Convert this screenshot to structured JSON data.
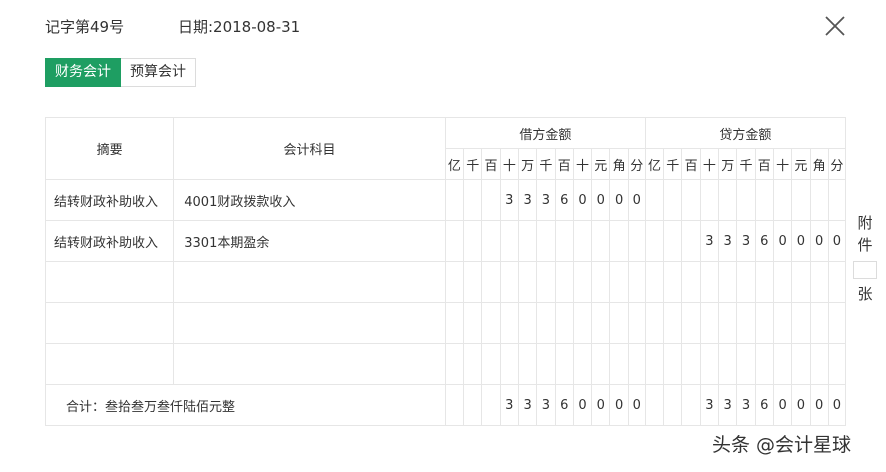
{
  "header": {
    "voucher_no": "记字第49号",
    "date": "日期:2018-08-31"
  },
  "tabs": [
    {
      "label": "财务会计",
      "active": true
    },
    {
      "label": "预算会计",
      "active": false
    }
  ],
  "table": {
    "col_summary": "摘要",
    "col_subject": "会计科目",
    "debit_title": "借方金额",
    "credit_title": "贷方金额",
    "digit_labels": [
      "亿",
      "千",
      "百",
      "十",
      "万",
      "千",
      "百",
      "十",
      "元",
      "角",
      "分"
    ],
    "rows": [
      {
        "summary": "结转财政补助收入",
        "subject": "4001财政拨款收入",
        "debit": [
          "",
          "",
          "",
          "3",
          "3",
          "3",
          "6",
          "0",
          "0",
          "0",
          "0"
        ],
        "credit": [
          "",
          "",
          "",
          "",
          "",
          "",
          "",
          "",
          "",
          "",
          ""
        ]
      },
      {
        "summary": "结转财政补助收入",
        "subject": "3301本期盈余",
        "debit": [
          "",
          "",
          "",
          "",
          "",
          "",
          "",
          "",
          "",
          "",
          ""
        ],
        "credit": [
          "",
          "",
          "",
          "3",
          "3",
          "3",
          "6",
          "0",
          "0",
          "0",
          "0"
        ]
      },
      {
        "summary": "",
        "subject": "",
        "debit": [
          "",
          "",
          "",
          "",
          "",
          "",
          "",
          "",
          "",
          "",
          ""
        ],
        "credit": [
          "",
          "",
          "",
          "",
          "",
          "",
          "",
          "",
          "",
          "",
          ""
        ]
      },
      {
        "summary": "",
        "subject": "",
        "debit": [
          "",
          "",
          "",
          "",
          "",
          "",
          "",
          "",
          "",
          "",
          ""
        ],
        "credit": [
          "",
          "",
          "",
          "",
          "",
          "",
          "",
          "",
          "",
          "",
          ""
        ]
      },
      {
        "summary": "",
        "subject": "",
        "debit": [
          "",
          "",
          "",
          "",
          "",
          "",
          "",
          "",
          "",
          "",
          ""
        ],
        "credit": [
          "",
          "",
          "",
          "",
          "",
          "",
          "",
          "",
          "",
          "",
          ""
        ]
      }
    ],
    "total": {
      "label": "合计：叁拾叁万叁仟陆佰元整",
      "debit": [
        "",
        "",
        "",
        "3",
        "3",
        "3",
        "6",
        "0",
        "0",
        "0",
        "0"
      ],
      "credit": [
        "",
        "",
        "",
        "3",
        "3",
        "3",
        "6",
        "0",
        "0",
        "0",
        "0"
      ]
    }
  },
  "attachment": {
    "label_top_1": "附",
    "label_top_2": "件",
    "label_bottom": "张",
    "count": ""
  },
  "watermark": "头条 @会计星球",
  "colors": {
    "accent": "#1e9e62",
    "digit_divider": "#b8d7ec",
    "yuan_divider": "#f2b4b4"
  }
}
